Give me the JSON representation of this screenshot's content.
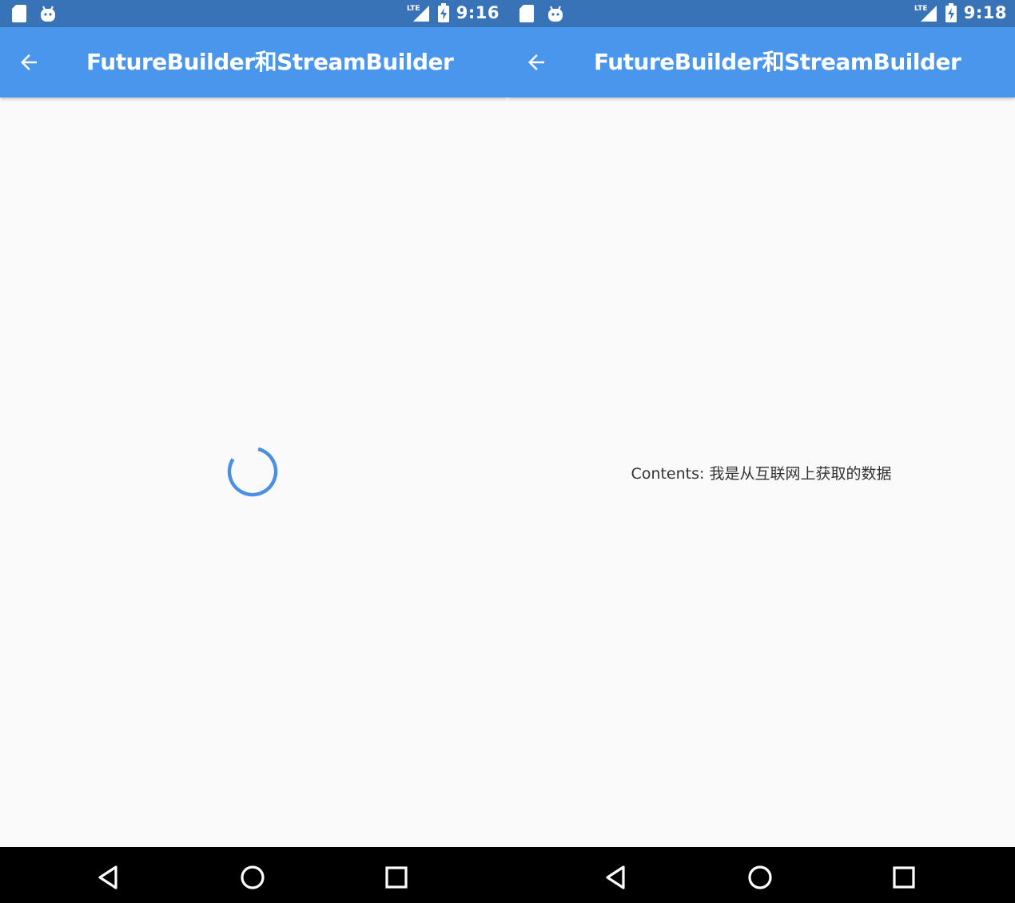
{
  "screens": [
    {
      "status_bar": {
        "time": "9:16",
        "icons": [
          "sd-card-icon",
          "android-icon",
          "lte-signal-icon",
          "battery-charging-icon"
        ]
      },
      "app_bar": {
        "back_icon": "arrow-back-icon",
        "title": "FutureBuilder和StreamBuilder"
      },
      "body": {
        "state": "loading",
        "indicator": "circular-progress-icon"
      },
      "nav_bar": {
        "buttons": [
          "back-triangle-icon",
          "home-circle-icon",
          "recents-square-icon"
        ]
      }
    },
    {
      "status_bar": {
        "time": "9:18",
        "icons": [
          "sd-card-icon",
          "android-icon",
          "lte-signal-icon",
          "battery-charging-icon"
        ]
      },
      "app_bar": {
        "back_icon": "arrow-back-icon",
        "title": "FutureBuilder和StreamBuilder"
      },
      "body": {
        "state": "loaded",
        "text": "Contents: 我是从互联网上获取的数据"
      },
      "nav_bar": {
        "buttons": [
          "back-triangle-icon",
          "home-circle-icon",
          "recents-square-icon"
        ]
      }
    }
  ],
  "colors": {
    "status_bar": "#3873b8",
    "app_bar": "#4a96ec",
    "background": "#fafafa",
    "accent": "#4a90e2",
    "nav_bar": "#000000"
  }
}
